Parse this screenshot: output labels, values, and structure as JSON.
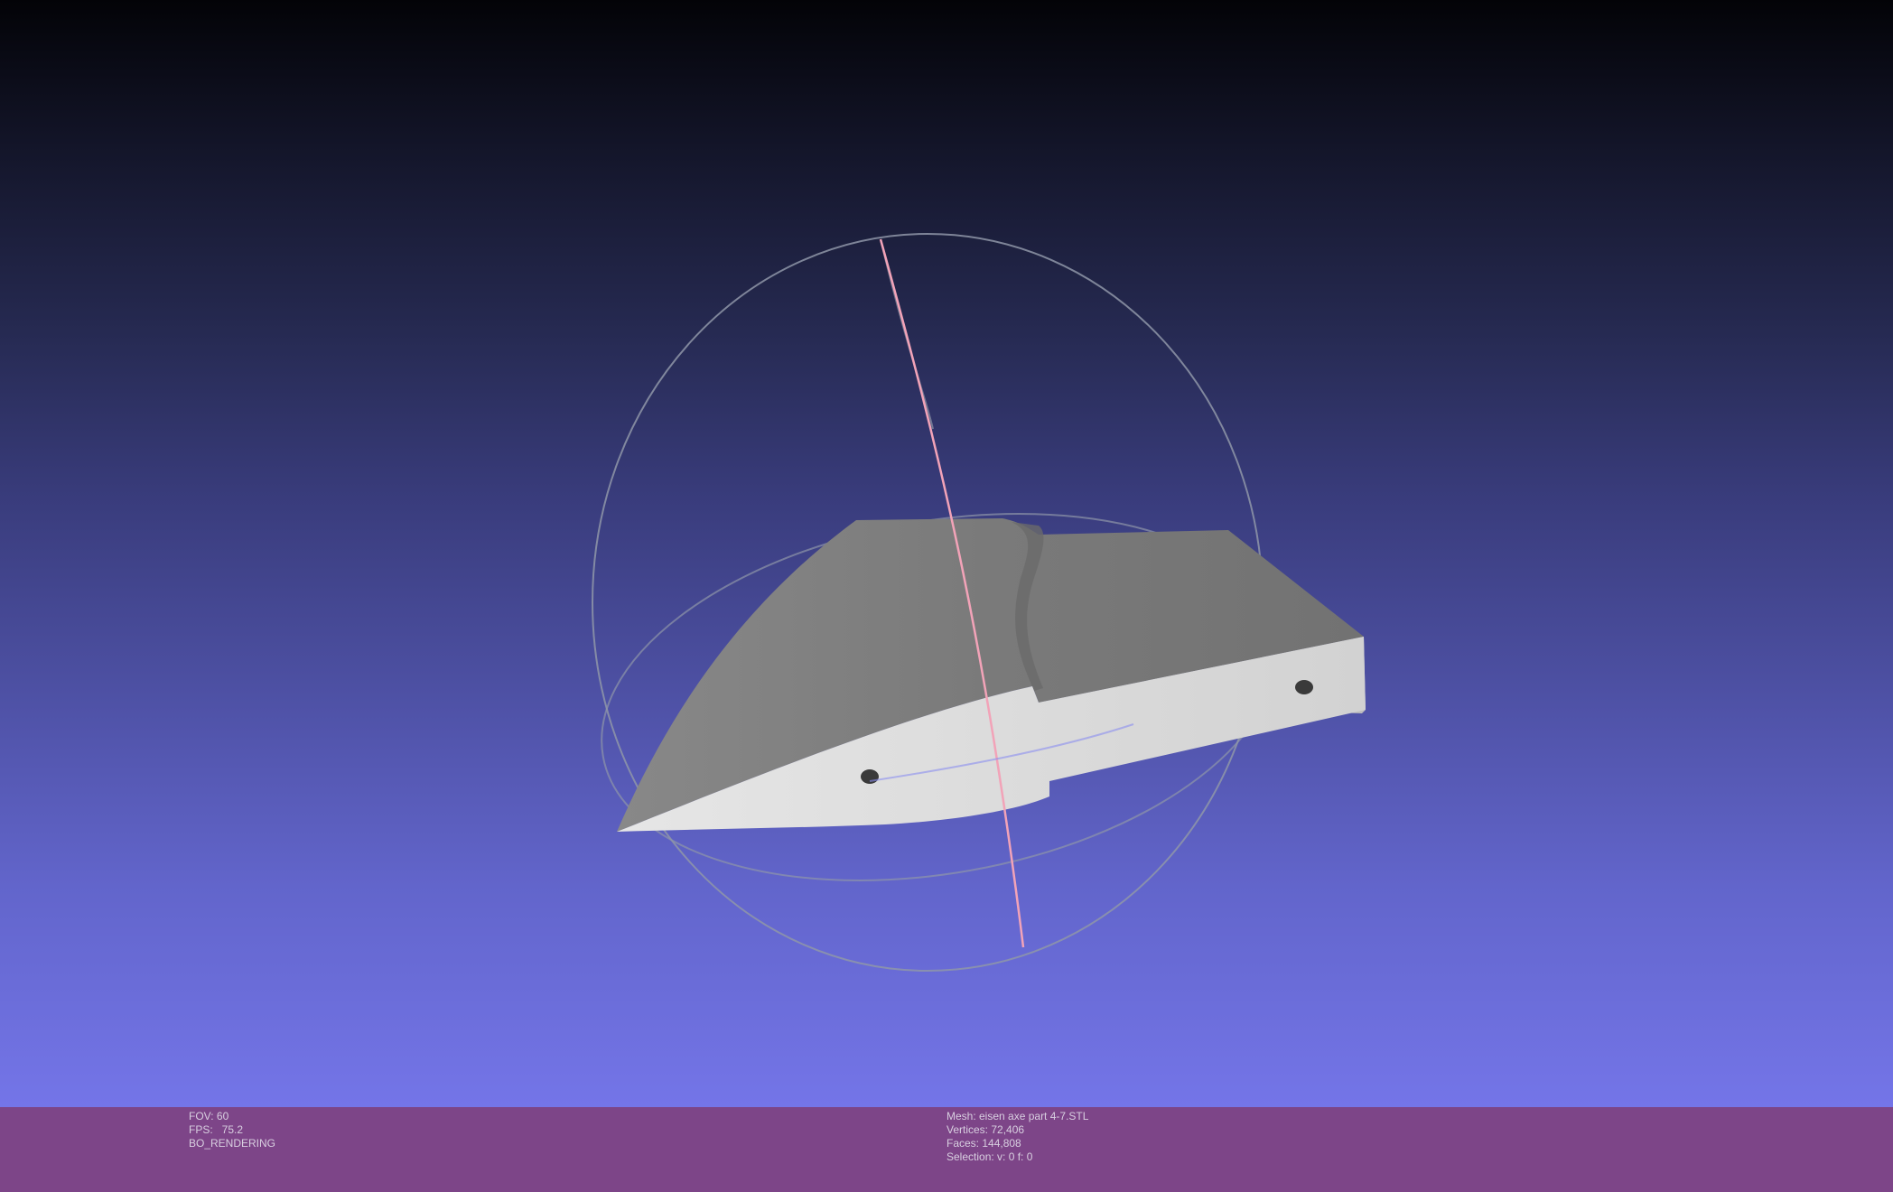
{
  "viewer": {
    "background_top": "#030307",
    "background_bottom": "#7475e8",
    "trackball_ring_color": "#8f96a8",
    "trackball_pink_color": "#f2a3b8",
    "trackball_blue_color": "#8a8ef0",
    "mesh_top_color": "#7b7b7b",
    "mesh_side_color": "#d9d9d9"
  },
  "status": {
    "bar_color": "#7d4588",
    "text_color": "#d8cfe0",
    "fov_label": "FOV: 60",
    "fps_label": "FPS:",
    "fps_value": "75.2",
    "render_mode": "BO_RENDERING",
    "mesh_name": "Mesh: eisen axe part 4-7.STL",
    "vertices": "Vertices: 72,406",
    "faces": "Faces: 144,808",
    "selection": "Selection: v: 0 f: 0"
  }
}
